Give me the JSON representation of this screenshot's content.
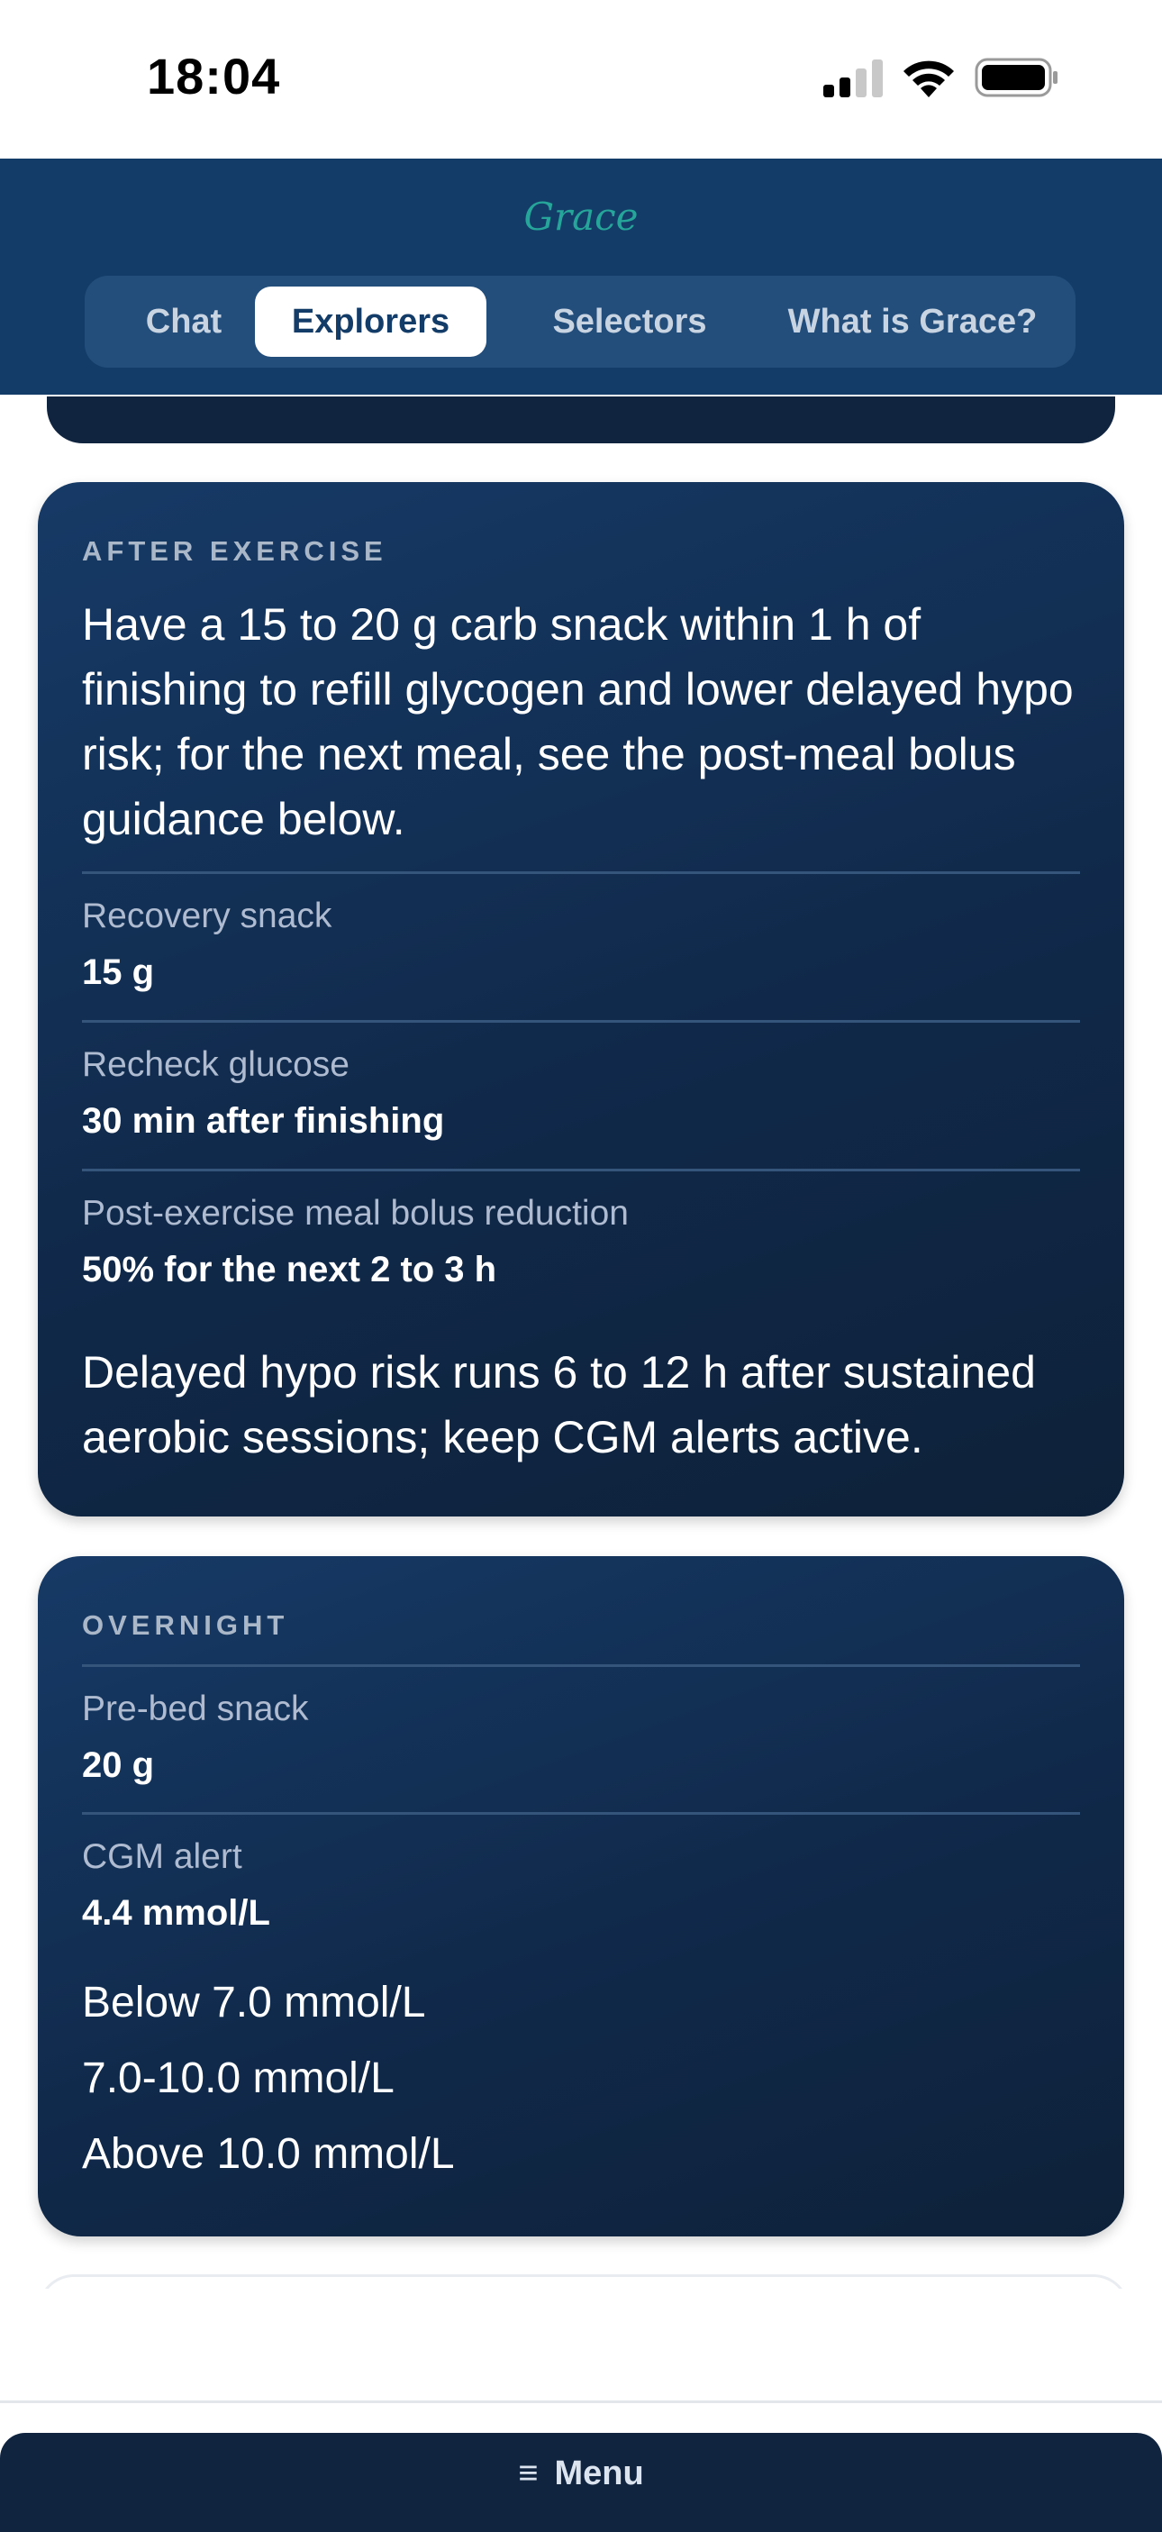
{
  "status_bar": {
    "time": "18:04",
    "icons": [
      "cellular-signal-icon",
      "wifi-icon",
      "battery-icon"
    ]
  },
  "header": {
    "brand": "Grace",
    "tabs": [
      {
        "label": "Chat",
        "active": false
      },
      {
        "label": "Explorers",
        "active": true
      },
      {
        "label": "Selectors",
        "active": false
      },
      {
        "label": "What is Grace?",
        "active": false
      }
    ]
  },
  "after_exercise": {
    "eyebrow": "AFTER EXERCISE",
    "summary": "Have a 15 to 20 g carb snack within 1 h of finishing to refill glycogen and lower delayed hypo risk; for the next meal, see the post-meal bolus guidance below.",
    "rows": [
      {
        "label": "Recovery snack",
        "value": "15 g"
      },
      {
        "label": "Recheck glucose",
        "value": "30 min after finishing"
      },
      {
        "label": "Post-exercise meal bolus reduction",
        "value": "50% for the next 2 to 3 h"
      }
    ],
    "note": "Delayed hypo risk runs 6 to 12 h after sustained aerobic sessions; keep CGM alerts active."
  },
  "overnight": {
    "eyebrow": "OVERNIGHT",
    "rows": [
      {
        "label": "Pre-bed snack",
        "value": "20 g"
      },
      {
        "label": "CGM alert",
        "value": "4.4 mmol/L"
      }
    ],
    "ranges": [
      "Below 7.0 mmol/L",
      "7.0-10.0 mmol/L",
      "Above 10.0 mmol/L"
    ]
  },
  "menu": {
    "icon": "hamburger-icon",
    "glyph": "≡",
    "label": "Menu"
  },
  "colors": {
    "header_bg": "#143c68",
    "brand": "#26a69a",
    "card_bg": "#10294a",
    "menu_bg": "#102440"
  }
}
